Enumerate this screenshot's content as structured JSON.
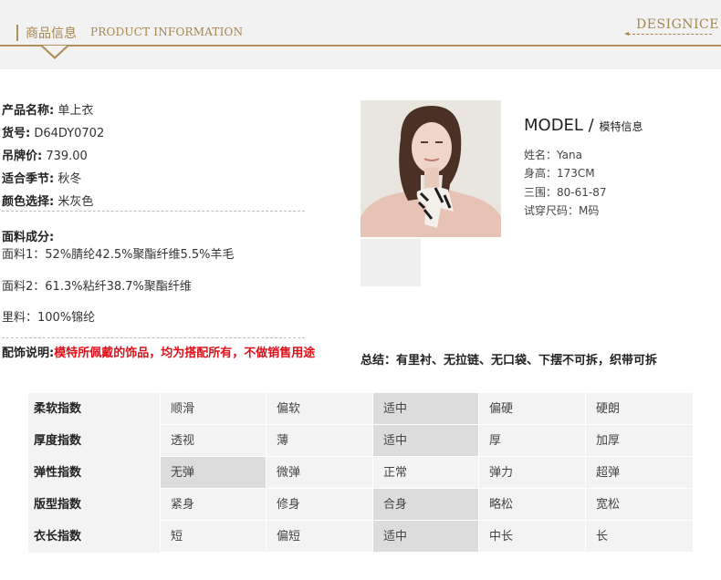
{
  "header": {
    "title_cn": "商品信息",
    "title_en": "PRODUCT INFORMATION",
    "brand": "DESIGNICE"
  },
  "product": {
    "name_label": "产品名称:",
    "name_value": "单上衣",
    "code_label": "货号:",
    "code_value": "D64DY0702",
    "price_label": "吊牌价:",
    "price_value": "739.00",
    "season_label": "适合季节:",
    "season_value": "秋冬",
    "color_label": "颜色选择:",
    "color_value": "米灰色",
    "fabric_label": "面料成分:",
    "fabric1": "面料1：52%腈纶42.5%聚酯纤维5.5%羊毛",
    "fabric2": "面料2：61.3%粘纤38.7%聚酯纤维",
    "lining": "里料：100%锦纶",
    "accessory_label": "配饰说明:",
    "accessory_note": "模特所佩戴的饰品，均为搭配所有，不做销售用途"
  },
  "model": {
    "title": "MODEL /",
    "title_cn": "模特信息",
    "name": "姓名：Yana",
    "height": "身高：173CM",
    "measurements": "三围：80-61-87",
    "size": "试穿尺码：M码"
  },
  "summary": "总结：有里衬、无拉链、无口袋、下摆不可拆，织带可拆",
  "colors": {
    "accent": "#b0905a",
    "highlight": "#dcdcdc",
    "table_bg": "#f3f3f3",
    "warning": "#e0101a"
  },
  "attributes": [
    {
      "label": "柔软指数",
      "options": [
        "顺滑",
        "偏软",
        "适中",
        "偏硬",
        "硬朗"
      ],
      "selected": 2
    },
    {
      "label": "厚度指数",
      "options": [
        "透视",
        " 薄",
        "适中",
        " 厚",
        "加厚"
      ],
      "selected": 2
    },
    {
      "label": "弹性指数",
      "options": [
        "无弹",
        "微弹",
        "正常",
        "弹力",
        "超弹"
      ],
      "selected": 0
    },
    {
      "label": "版型指数",
      "options": [
        "紧身",
        "修身",
        "合身",
        "略松",
        "宽松"
      ],
      "selected": 2
    },
    {
      "label": "衣长指数",
      "options": [
        " 短",
        "偏短",
        "适中",
        "中长",
        " 长"
      ],
      "selected": 2
    }
  ]
}
